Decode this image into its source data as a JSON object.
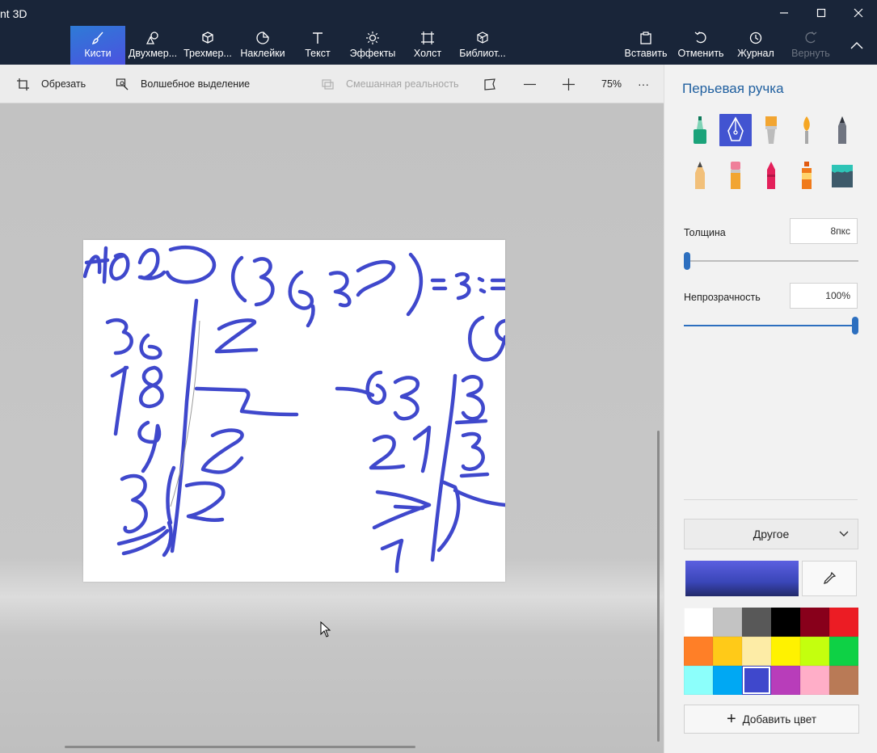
{
  "window": {
    "title": "nt 3D"
  },
  "ribbon": {
    "tools": [
      {
        "label": "Кисти",
        "icon": "brush-icon",
        "active": true
      },
      {
        "label": "Двухмер...",
        "icon": "shapes-2d-icon"
      },
      {
        "label": "Трехмер...",
        "icon": "cube-3d-icon"
      },
      {
        "label": "Наклейки",
        "icon": "sticker-icon"
      },
      {
        "label": "Текст",
        "icon": "text-icon"
      },
      {
        "label": "Эффекты",
        "icon": "effects-sun-icon"
      },
      {
        "label": "Холст",
        "icon": "canvas-crop-icon"
      },
      {
        "label": "Библиот...",
        "icon": "library-icon"
      }
    ],
    "actions": [
      {
        "label": "Вставить",
        "icon": "paste-icon"
      },
      {
        "label": "Отменить",
        "icon": "undo-icon"
      },
      {
        "label": "Журнал",
        "icon": "history-icon"
      },
      {
        "label": "Вернуть",
        "icon": "redo-icon",
        "disabled": true
      }
    ]
  },
  "subbar": {
    "crop_label": "Обрезать",
    "magic_select_label": "Волшебное выделение",
    "mixed_reality_label": "Смешанная реальность",
    "zoom_value": "75%",
    "more_label": "···"
  },
  "panel": {
    "title": "Перьевая ручка",
    "thickness_label": "Толщина",
    "thickness_value": "8пкс",
    "thickness_level": 0.0,
    "opacity_label": "Непрозрачность",
    "opacity_value": "100%",
    "opacity_level": 1.0,
    "color_dropdown_label": "Другое",
    "current_color": "#3f48cc",
    "add_color_label": "Добавить цвет",
    "palette": [
      "#ffffff",
      "#c3c3c3",
      "#585858",
      "#000000",
      "#88001b",
      "#ec1c24",
      "#ff7f27",
      "#ffca18",
      "#fdeca6",
      "#fff200",
      "#c4ff0e",
      "#0ed145",
      "#8cfffb",
      "#00a8f3",
      "#3f48cc",
      "#b83dba",
      "#ffaec8",
      "#b97a56"
    ],
    "selected_palette_index": 14
  }
}
